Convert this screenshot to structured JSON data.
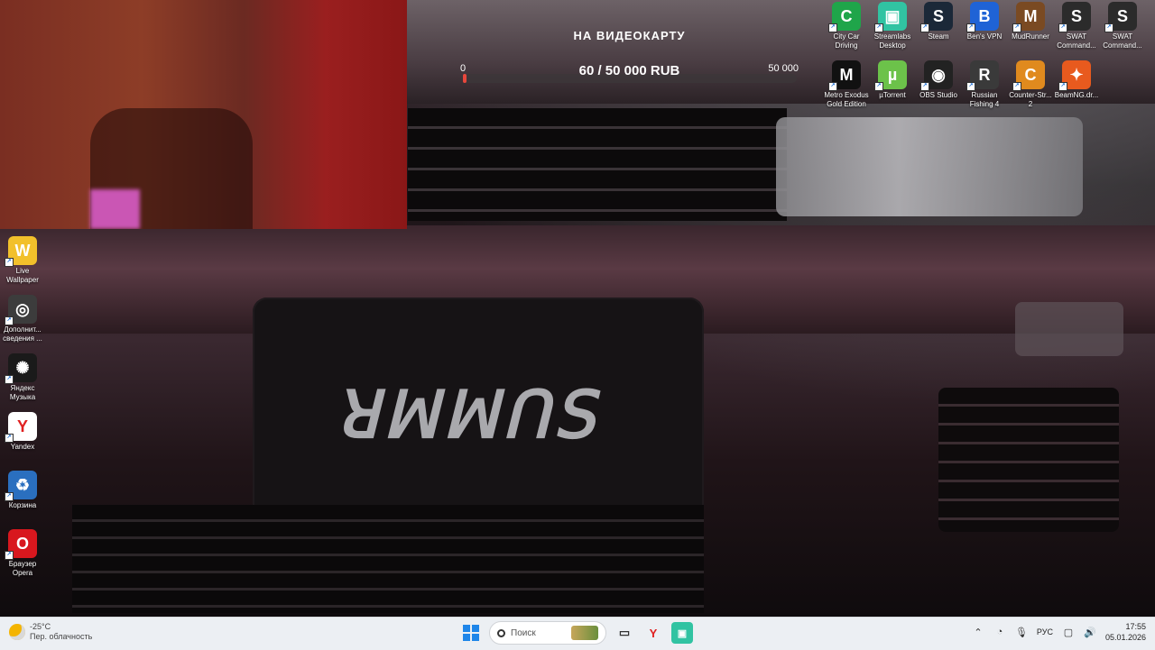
{
  "donation_widget": {
    "title": "НА ВИДЕОКАРТУ",
    "min_label": "0",
    "max_label": "50 000",
    "amount_text": "60 / 50 000 RUB",
    "progress_fraction": 0.0012
  },
  "desktop_top_icons": [
    {
      "label": "City Car Driving",
      "icon": "city-car-driving-icon",
      "color": "#1fa54a",
      "glyph": "C"
    },
    {
      "label": "Streamlabs Desktop",
      "icon": "streamlabs-icon",
      "color": "#31c3a2",
      "glyph": "▣"
    },
    {
      "label": "Steam",
      "icon": "steam-icon",
      "color": "#1b2838",
      "glyph": "S"
    },
    {
      "label": "Ben's VPN",
      "icon": "bens-vpn-icon",
      "color": "#1f63d6",
      "glyph": "B"
    },
    {
      "label": "MudRunner",
      "icon": "mudrunner-icon",
      "color": "#7a4a22",
      "glyph": "M"
    },
    {
      "label": "SWAT Command...",
      "icon": "swat-icon",
      "color": "#2b2b2b",
      "glyph": "S"
    },
    {
      "label": "SWAT Command...",
      "icon": "swat-icon-2",
      "color": "#2b2b2b",
      "glyph": "S"
    },
    {
      "label": "Metro Exodus Gold Edition",
      "icon": "metro-exodus-icon",
      "color": "#111111",
      "glyph": "M"
    },
    {
      "label": "µTorrent",
      "icon": "utorrent-icon",
      "color": "#6cc24a",
      "glyph": "µ"
    },
    {
      "label": "OBS Studio",
      "icon": "obs-icon",
      "color": "#222222",
      "glyph": "◉"
    },
    {
      "label": "Russian Fishing 4",
      "icon": "russian-fishing-icon",
      "color": "#3a3a3a",
      "glyph": "R"
    },
    {
      "label": "Counter-Str... 2",
      "icon": "counter-strike-icon",
      "color": "#e08a1e",
      "glyph": "C"
    },
    {
      "label": "BeamNG.dr...",
      "icon": "beamng-icon",
      "color": "#e85a1e",
      "glyph": "✦"
    }
  ],
  "desktop_left_icons": [
    {
      "label": "Live Wallpaper",
      "icon": "live-wallpaper-icon",
      "color": "#f2c02b",
      "glyph": "W"
    },
    {
      "label": "Дополнит... сведения ...",
      "icon": "info-icon",
      "color": "#3c3c3c",
      "glyph": "◎"
    },
    {
      "label": "Яндекс Музыка",
      "icon": "yandex-music-icon",
      "color": "#1a1a1a",
      "glyph": "✺"
    },
    {
      "label": "Yandex",
      "icon": "yandex-browser-icon",
      "color": "#ffffff",
      "glyph": "Y"
    },
    {
      "label": "Корзина",
      "icon": "recycle-bin-icon",
      "color": "#2a6fbf",
      "glyph": "♻"
    },
    {
      "label": "Браузер Opera",
      "icon": "opera-icon",
      "color": "#d8171e",
      "glyph": "O"
    }
  ],
  "taskbar": {
    "weather_temp": "-25°C",
    "weather_desc": "Пер. облачность",
    "search_placeholder": "Поиск",
    "language": "РУС",
    "time": "17:55",
    "date": "05.01.2026"
  }
}
